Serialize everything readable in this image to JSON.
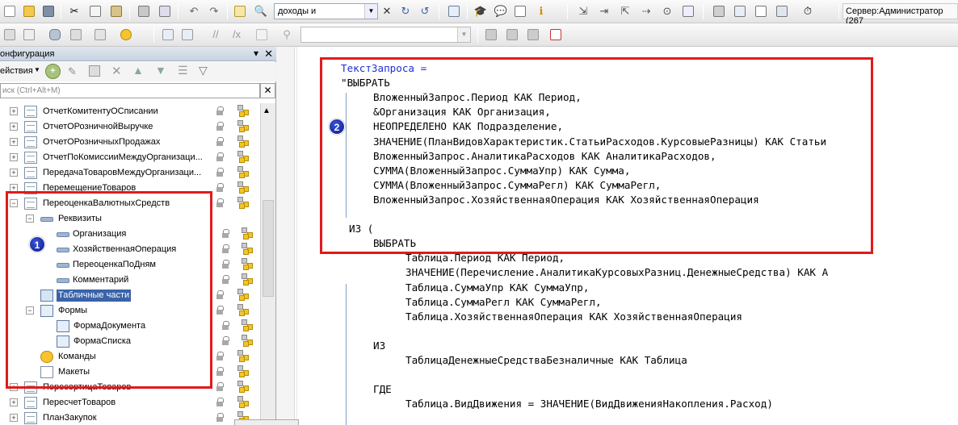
{
  "toolbar": {
    "search_value": "доходы и",
    "server_label": "Сервер:Администратор (267"
  },
  "config_panel": {
    "title": "онфигурация",
    "actions_label": "ействия",
    "search_placeholder": "иск (Ctrl+Alt+M)"
  },
  "tree": [
    {
      "label": "ОтчетКомитентуОСписании",
      "icon": "doc-icon",
      "expander": "+"
    },
    {
      "label": "ОтчетОРозничнойВыручке",
      "icon": "doc-icon",
      "expander": "+"
    },
    {
      "label": "ОтчетОРозничныхПродажах",
      "icon": "doc-icon",
      "expander": "+"
    },
    {
      "label": "ОтчетПоКомиссииМеждуОрганизаци...",
      "icon": "doc-icon",
      "expander": "+"
    },
    {
      "label": "ПередачаТоваровМеждуОрганизаци...",
      "icon": "doc-icon",
      "expander": "+"
    },
    {
      "label": "ПеремещениеТоваров",
      "icon": "doc-icon",
      "expander": "+"
    },
    {
      "label": "ПереоценкаВалютныхСредств",
      "icon": "doc-icon",
      "expander": "−"
    },
    {
      "label": "Реквизиты",
      "icon": "attributes-icon",
      "expander": "−"
    },
    {
      "label": "Организация",
      "icon": "attribute-icon",
      "expander": ""
    },
    {
      "label": "ХозяйственнаяОперация",
      "icon": "attribute-icon",
      "expander": ""
    },
    {
      "label": "ПереоценкаПоДням",
      "icon": "attribute-icon",
      "expander": ""
    },
    {
      "label": "Комментарий",
      "icon": "attribute-icon",
      "expander": ""
    },
    {
      "label": "Табличные части",
      "icon": "tabular-icon",
      "expander": ""
    },
    {
      "label": "Формы",
      "icon": "forms-icon",
      "expander": "−"
    },
    {
      "label": "ФормаДокумента",
      "icon": "form-icon",
      "expander": ""
    },
    {
      "label": "ФормаСписка",
      "icon": "form-icon",
      "expander": ""
    },
    {
      "label": "Команды",
      "icon": "commands-icon",
      "expander": ""
    },
    {
      "label": "Макеты",
      "icon": "templates-icon",
      "expander": ""
    },
    {
      "label": "ПересортицаТоваров",
      "icon": "doc-icon",
      "expander": "+"
    },
    {
      "label": "ПересчетТоваров",
      "icon": "doc-icon",
      "expander": "+"
    },
    {
      "label": "ПланЗакупок",
      "icon": "doc-icon",
      "expander": "+"
    }
  ],
  "code": [
    {
      "text": "ТекстЗапроса =",
      "style": "blue"
    },
    {
      "text": "\"ВЫБРАТЬ",
      "style": "normal"
    },
    {
      "text": "ВложенныйЗапрос.Период КАК Период,",
      "style": "normal"
    },
    {
      "text": "&Организация КАК Организация,",
      "style": "normal"
    },
    {
      "text": "НЕОПРЕДЕЛЕНО КАК Подразделение,",
      "style": "normal"
    },
    {
      "text": "ЗНАЧЕНИЕ(ПланВидовХарактеристик.СтатьиРасходов.КурсовыеРазницы) КАК Статьи",
      "style": "normal"
    },
    {
      "text": "ВложенныйЗапрос.АналитикаРасходов КАК АналитикаРасходов,",
      "style": "normal"
    },
    {
      "text": "СУММА(ВложенныйЗапрос.СуммаУпр) КАК Сумма,",
      "style": "normal"
    },
    {
      "text": "СУММА(ВложенныйЗапрос.СуммаРегл) КАК СуммаРегл,",
      "style": "normal"
    },
    {
      "text": "ВложенныйЗапрос.ХозяйственнаяОперация КАК ХозяйственнаяОперация",
      "style": "normal"
    },
    {
      "text": "",
      "style": "normal"
    },
    {
      "text": "ИЗ (",
      "style": "normal"
    },
    {
      "text": "ВЫБРАТЬ",
      "style": "normal"
    },
    {
      "text": "Таблица.Период КАК Период,",
      "style": "normal"
    },
    {
      "text": "ЗНАЧЕНИЕ(Перечисление.АналитикаКурсовыхРазниц.ДенежныеСредства) КАК А",
      "style": "normal"
    },
    {
      "text": "Таблица.СуммаУпр КАК СуммаУпр,",
      "style": "normal"
    },
    {
      "text": "Таблица.СуммаРегл КАК СуммаРегл,",
      "style": "normal"
    },
    {
      "text": "Таблица.ХозяйственнаяОперация КАК ХозяйственнаяОперация",
      "style": "normal"
    },
    {
      "text": "",
      "style": "normal"
    },
    {
      "text": "ИЗ",
      "style": "normal"
    },
    {
      "text": "ТаблицаДенежныеСредстваБезналичные КАК Таблица",
      "style": "normal"
    },
    {
      "text": "",
      "style": "normal"
    },
    {
      "text": "ГДЕ",
      "style": "normal"
    },
    {
      "text": "Таблица.ВидДвижения = ЗНАЧЕНИЕ(ВидДвиженияНакопления.Расход)",
      "style": "normal"
    }
  ],
  "badges": {
    "one": "1",
    "two": "2"
  },
  "colors": {
    "highlight_red": "#e21a1a",
    "keyword_blue": "#1f2fd0",
    "selection": "#3a63a8"
  }
}
